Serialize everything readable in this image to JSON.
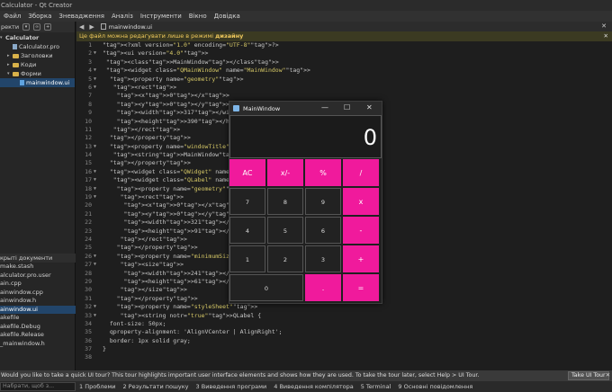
{
  "window_title": "Calculator - Qt Creator",
  "menu": [
    "Файл",
    "Зборка",
    "Зневадження",
    "Аналіз",
    "Інструменти",
    "Вікно",
    "Довідка"
  ],
  "sidebar": {
    "toolbar_label": "ректи",
    "tree": [
      {
        "label": "Calculator",
        "kind": "project",
        "expanded": true
      },
      {
        "label": "Calculator.pro",
        "kind": "file"
      },
      {
        "label": "Заголовки",
        "kind": "folder"
      },
      {
        "label": "Коди",
        "kind": "folder"
      },
      {
        "label": "Форми",
        "kind": "folder",
        "expanded": true
      },
      {
        "label": "mainwindow.ui",
        "kind": "file-ui",
        "selected": true
      }
    ],
    "open_docs_header": "крыті документи",
    "open_docs": [
      "make.stash",
      "alculator.pro.user",
      "ain.cpp",
      "ainwindow.cpp",
      "ainwindow.h",
      "ainwindow.ui",
      "akefile",
      "akefile.Debug",
      "akefile.Release",
      "_mainwindow.h"
    ],
    "open_docs_selected_index": 5
  },
  "editor": {
    "tab_label": "mainwindow.ui",
    "info_text": "Це файл можна редагувати лише в режимі ",
    "info_bold": "дизайну",
    "lines": [
      {
        "n": "1",
        "fold": "",
        "text": "<?xml version=\"1.0\" encoding=\"UTF-8\"?>"
      },
      {
        "n": "2",
        "fold": "▼",
        "text": "<ui version=\"4.0\">"
      },
      {
        "n": "3",
        "fold": "",
        "text": " <class>MainWindow</class>"
      },
      {
        "n": "4",
        "fold": "▼",
        "text": " <widget class=\"QMainWindow\" name=\"MainWindow\">"
      },
      {
        "n": "5",
        "fold": "▼",
        "text": "  <property name=\"geometry\">"
      },
      {
        "n": "6",
        "fold": "▼",
        "text": "   <rect>"
      },
      {
        "n": "7",
        "fold": "",
        "text": "    <x>0</x>"
      },
      {
        "n": "8",
        "fold": "",
        "text": "    <y>0</y>"
      },
      {
        "n": "9",
        "fold": "",
        "text": "    <width>317</width>"
      },
      {
        "n": "10",
        "fold": "",
        "text": "    <height>390</height>"
      },
      {
        "n": "11",
        "fold": "",
        "text": "   </rect>"
      },
      {
        "n": "12",
        "fold": "",
        "text": "  </property>"
      },
      {
        "n": "13",
        "fold": "▼",
        "text": "  <property name=\"windowTitle\">"
      },
      {
        "n": "14",
        "fold": "",
        "text": "   <string>MainWindow</string>"
      },
      {
        "n": "15",
        "fold": "",
        "text": "  </property>"
      },
      {
        "n": "16",
        "fold": "▼",
        "text": "  <widget class=\"QWidget\" name=\""
      },
      {
        "n": "17",
        "fold": "▼",
        "text": "   <widget class=\"QLabel\" name=\""
      },
      {
        "n": "18",
        "fold": "▼",
        "text": "    <property name=\"geometry\">"
      },
      {
        "n": "19",
        "fold": "▼",
        "text": "     <rect>"
      },
      {
        "n": "20",
        "fold": "",
        "text": "      <x>0</x>"
      },
      {
        "n": "21",
        "fold": "",
        "text": "      <y>0</y>"
      },
      {
        "n": "22",
        "fold": "",
        "text": "      <width>321</width>"
      },
      {
        "n": "23",
        "fold": "",
        "text": "      <height>91</height>"
      },
      {
        "n": "24",
        "fold": "",
        "text": "     </rect>"
      },
      {
        "n": "25",
        "fold": "",
        "text": "    </property>"
      },
      {
        "n": "26",
        "fold": "▼",
        "text": "    <property name=\"minimumSize\">"
      },
      {
        "n": "27",
        "fold": "▼",
        "text": "     <size>"
      },
      {
        "n": "28",
        "fold": "",
        "text": "      <width>241</width>"
      },
      {
        "n": "29",
        "fold": "",
        "text": "      <height>61</height>"
      },
      {
        "n": "30",
        "fold": "",
        "text": "     </size>"
      },
      {
        "n": "31",
        "fold": "",
        "text": "    </property>"
      },
      {
        "n": "32",
        "fold": "▼",
        "text": "    <property name=\"styleSheet\">"
      },
      {
        "n": "33",
        "fold": "▼",
        "text": "     <string notr=\"true\">QLabel {"
      },
      {
        "n": "34",
        "fold": "",
        "text": "  font-size: 50px;"
      },
      {
        "n": "35",
        "fold": "",
        "text": "  qproperty-alignment: 'AlignVCenter | AlignRight';"
      },
      {
        "n": "36",
        "fold": "",
        "text": "  border: 1px solid gray;"
      },
      {
        "n": "37",
        "fold": "",
        "text": "}"
      },
      {
        "n": "38",
        "fold": "",
        "text": ""
      }
    ]
  },
  "status_message": "Would you like to take a quick UI tour? This tour highlights important user interface elements and shows how they are used. To take the tour later, select Help > UI Tour.",
  "tour_button": "Take UI Tour",
  "bottom": {
    "search_placeholder": "Набрати, щоб з...",
    "panes": [
      "1 Проблеми",
      "2 Результати пошуку",
      "3 Виведення програми",
      "4 Виведення компілятора",
      "5 Terminal",
      "9 Основні повідомлення"
    ]
  },
  "calculator": {
    "title": "MainWindow",
    "display": "0",
    "keys": [
      {
        "label": "AC",
        "style": "pink"
      },
      {
        "label": "x/-",
        "style": "pink"
      },
      {
        "label": "%",
        "style": "pink"
      },
      {
        "label": "/",
        "style": "op"
      },
      {
        "label": "7",
        "style": "num"
      },
      {
        "label": "8",
        "style": "num"
      },
      {
        "label": "9",
        "style": "num"
      },
      {
        "label": "x",
        "style": "op"
      },
      {
        "label": "4",
        "style": "num"
      },
      {
        "label": "5",
        "style": "num"
      },
      {
        "label": "6",
        "style": "num"
      },
      {
        "label": "-",
        "style": "op"
      },
      {
        "label": "1",
        "style": "num"
      },
      {
        "label": "2",
        "style": "num"
      },
      {
        "label": "3",
        "style": "num"
      },
      {
        "label": "+",
        "style": "op"
      },
      {
        "label": "0",
        "style": "num"
      },
      {
        "label": ".",
        "style": "op"
      },
      {
        "label": "=",
        "style": "op"
      }
    ]
  },
  "colors": {
    "accent": "#f01a9c",
    "info_bg": "#3b3a22",
    "selection": "#22456a"
  }
}
